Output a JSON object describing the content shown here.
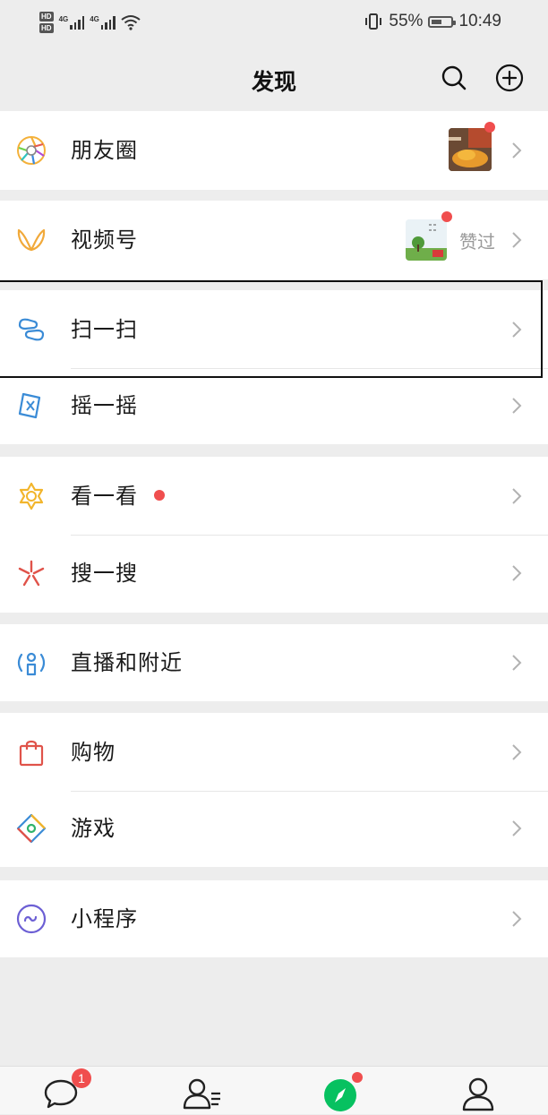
{
  "status_bar": {
    "hd_labels": [
      "HD",
      "HD"
    ],
    "network_labels": [
      "4G",
      "4G"
    ],
    "battery_percent": "55%",
    "battery_level": 0.55,
    "time": "10:49"
  },
  "header": {
    "title": "发现",
    "search_icon": "search-icon",
    "add_icon": "add-circle-icon"
  },
  "menu": {
    "moments": {
      "label": "朋友圈",
      "icon": "moments-shutter-icon",
      "has_red_dot": true
    },
    "channels": {
      "label": "视频号",
      "icon": "channels-butterfly-icon",
      "side_text": "赞过",
      "has_red_dot": true
    },
    "scan": {
      "label": "扫一扫",
      "icon": "scan-icon"
    },
    "shake": {
      "label": "摇一摇",
      "icon": "shake-icon"
    },
    "top_stories": {
      "label": "看一看",
      "icon": "top-stories-icon",
      "has_red_dot": true
    },
    "search": {
      "label": "搜一搜",
      "icon": "search-star-icon"
    },
    "live_nearby": {
      "label": "直播和附近",
      "icon": "live-nearby-icon"
    },
    "shopping": {
      "label": "购物",
      "icon": "shopping-bag-icon"
    },
    "games": {
      "label": "游戏",
      "icon": "games-icon"
    },
    "mini_programs": {
      "label": "小程序",
      "icon": "mini-programs-icon"
    }
  },
  "tab_bar": {
    "chats_badge": "1",
    "tabs": [
      "chats-icon",
      "contacts-icon",
      "discover-icon",
      "me-icon"
    ]
  },
  "colors": {
    "background": "#ededed",
    "red_dot": "#f04e4e",
    "discover_green": "#07c160"
  }
}
